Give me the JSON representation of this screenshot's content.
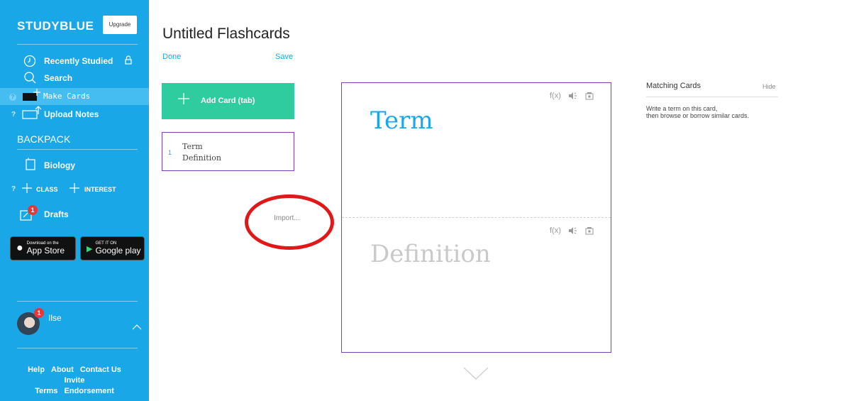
{
  "app": {
    "brand": "STUDYBLUE",
    "upgrade_label": "Upgrade"
  },
  "sidebar": {
    "items": [
      {
        "label": "Recently Studied",
        "icon": "clock-icon",
        "extra_icon": "lock-icon"
      },
      {
        "label": "Search",
        "icon": "search-icon"
      },
      {
        "label": "Make Cards",
        "icon": "make-cards-icon",
        "help": "?"
      },
      {
        "label": "Upload Notes",
        "icon": "upload-icon",
        "help": "?"
      }
    ],
    "section_title": "BACKPACK",
    "backpack": [
      {
        "label": "Biology",
        "icon": "notebook-icon"
      }
    ],
    "add_class_label": "CLASS",
    "add_interest_label": "INTEREST",
    "class_help": "?",
    "drafts_label": "Drafts",
    "drafts_badge": "1",
    "app_store": {
      "small": "Download on the",
      "big": "App Store"
    },
    "google_play": {
      "small": "GET IT ON",
      "big": "Google play"
    },
    "user": {
      "name": "Ilse",
      "badge": "1"
    },
    "footer": {
      "row1": [
        "Help",
        "About",
        "Contact Us"
      ],
      "row2": [
        "Invite"
      ],
      "row3": [
        "Terms",
        "Endorsement"
      ]
    }
  },
  "main": {
    "title": "Untitled Flashcards",
    "done_label": "Done",
    "save_label": "Save",
    "add_card_label": "Add Card (tab)",
    "cards": [
      {
        "number": "1",
        "term": "Term",
        "definition": "Definition"
      }
    ],
    "import_label": "Import...",
    "editor": {
      "term_placeholder": "Term",
      "definition_placeholder": "Definition",
      "tools": [
        "f(x)",
        "audio",
        "camera"
      ]
    }
  },
  "matching": {
    "title": "Matching Cards",
    "hide_label": "Hide",
    "text_line1": "Write a term on this card,",
    "text_line2": "then browse or borrow similar cards."
  },
  "colors": {
    "sidebar": "#1aa7e8",
    "accent_green": "#2ecc9f",
    "card_border": "#7d3fb8",
    "annotation_red": "#e01818"
  }
}
